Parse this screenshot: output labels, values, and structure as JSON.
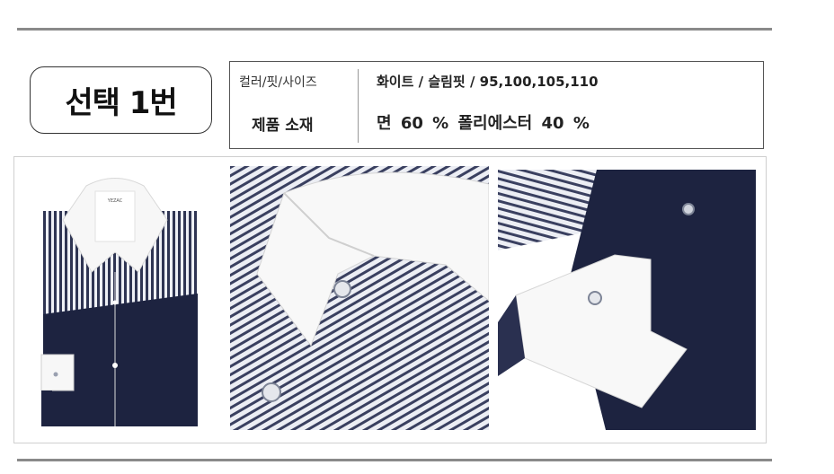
{
  "option": {
    "title": "선택 1번"
  },
  "spec": {
    "row1_label": "컬러/핏/사이즈",
    "row1_value": "화이트  /  슬림핏  /  95,100,105,110",
    "row2_label": "제품 소재",
    "row2_value": "면  60 %   폴리에스터  40 %"
  },
  "gallery": {
    "images": [
      {
        "name": "shirt-folded-front"
      },
      {
        "name": "shirt-collar-closeup"
      },
      {
        "name": "shirt-cuff-closeup"
      }
    ]
  },
  "colors": {
    "navy": "#1d2340",
    "stripe": "#2f3553",
    "white": "#f7f7f7",
    "rule": "#8a8a8a"
  }
}
